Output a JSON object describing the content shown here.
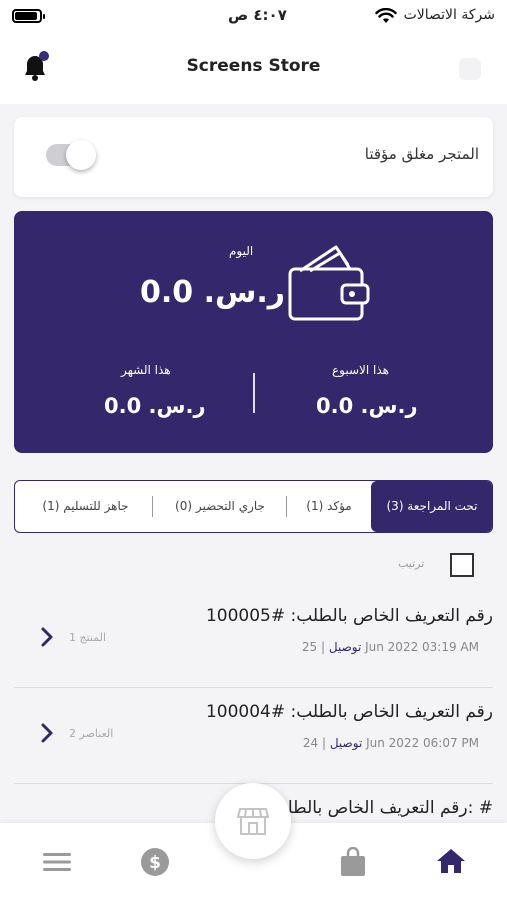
{
  "status_bar": {
    "time": "٤:٠٧ ص",
    "carrier": "شركة الاتصالات"
  },
  "header": {
    "title": "Screens Store"
  },
  "store_status": {
    "label": "المتجر مغلق مؤقتا",
    "toggle_on": false
  },
  "earnings": {
    "today_label": "اليوم",
    "today_value": "ر.س. 0.0",
    "week_label": "هذا الاسبوع",
    "week_value": "ر.س. 0.0",
    "month_label": "هذا الشهر",
    "month_value": "ر.س. 0.0"
  },
  "tabs": [
    {
      "label": "تحت المراجعة (3)",
      "active": true
    },
    {
      "label": "مؤكد (1)",
      "active": false
    },
    {
      "label": "جاري التحضير (0)",
      "active": false
    },
    {
      "label": "جاهز للتسليم (1)",
      "active": false
    }
  ],
  "sort": {
    "label": "ترتيب"
  },
  "orders": [
    {
      "title": "رقم التعريف الخاص بالطلب: #100005",
      "date": "25 Jun 2022   03:19 AM",
      "type": "توصيل",
      "count": "1 المنتج"
    },
    {
      "title": "رقم التعريف الخاص بالطلب: #100004",
      "date": "24 Jun 2022   06:07 PM",
      "type": "توصيل",
      "count": "2 العناصر"
    },
    {
      "title": "رقم التعريف الخاص بالطلب: #",
      "date": "",
      "type": "",
      "count": ""
    }
  ],
  "colors": {
    "primary": "#34276b",
    "notification_dot": "#3a2a7a"
  },
  "icons": {
    "bell": "bell-icon",
    "wallet": "wallet-icon",
    "menu": "menu-icon",
    "dollar": "dollar-icon",
    "bag": "bag-icon",
    "home": "home-icon",
    "store": "store-icon"
  }
}
